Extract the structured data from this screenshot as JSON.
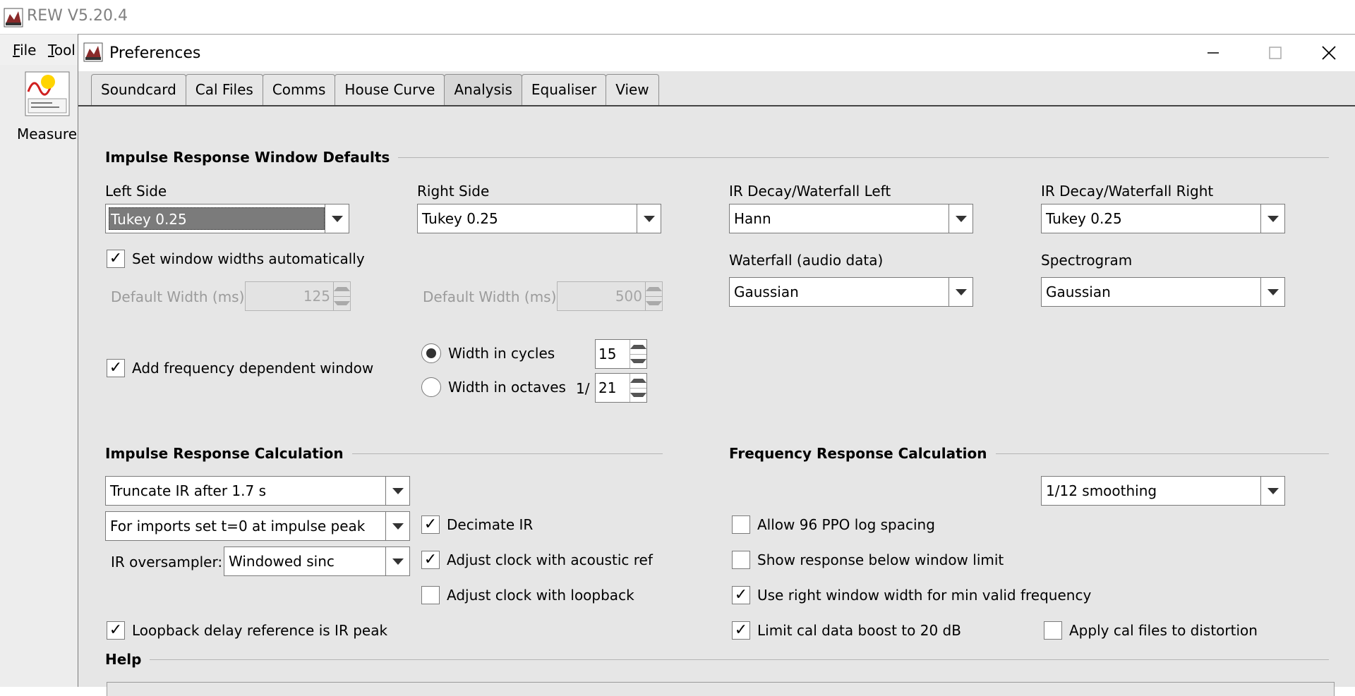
{
  "app": {
    "title": "REW V5.20.4",
    "menu": {
      "file": "File",
      "tools": "Tool"
    },
    "measure_label": "Measure"
  },
  "dialog": {
    "title": "Preferences",
    "tabs": [
      "Soundcard",
      "Cal Files",
      "Comms",
      "House Curve",
      "Analysis",
      "Equaliser",
      "View"
    ],
    "active_tab": "Analysis"
  },
  "ir_window": {
    "section_title": "Impulse Response Window Defaults",
    "left_side": {
      "label": "Left Side",
      "value": "Tukey 0.25"
    },
    "right_side": {
      "label": "Right Side",
      "value": "Tukey 0.25"
    },
    "ir_decay_left": {
      "label": "IR Decay/Waterfall Left",
      "value": "Hann"
    },
    "ir_decay_right": {
      "label": "IR Decay/Waterfall Right",
      "value": "Tukey 0.25"
    },
    "waterfall_audio": {
      "label": "Waterfall (audio data)",
      "value": "Gaussian"
    },
    "spectrogram": {
      "label": "Spectrogram",
      "value": "Gaussian"
    },
    "set_widths_auto": {
      "label": "Set window widths automatically",
      "checked": true
    },
    "left_default_width": {
      "label": "Default Width (ms)",
      "value": "125"
    },
    "right_default_width": {
      "label": "Default Width (ms)",
      "value": "500"
    },
    "freq_dependent": {
      "label": "Add frequency dependent window",
      "checked": true
    },
    "width_cycles": {
      "label": "Width in cycles",
      "value": "15",
      "selected": true
    },
    "width_octaves": {
      "label": "Width in octaves",
      "prefix": "1/",
      "value": "21",
      "selected": false
    }
  },
  "ir_calc": {
    "section_title": "Impulse Response Calculation",
    "truncate": "Truncate IR after 1.7 s",
    "imports": "For imports set t=0 at impulse peak",
    "oversampler_label": "IR oversampler:",
    "oversampler": "Windowed sinc",
    "decimate": {
      "label": "Decimate IR",
      "checked": true
    },
    "adjust_acoustic": {
      "label": "Adjust clock with acoustic ref",
      "checked": true
    },
    "adjust_loopback": {
      "label": "Adjust clock with loopback",
      "checked": false
    },
    "loopback_delay": {
      "label": "Loopback delay reference is IR peak",
      "checked": true
    }
  },
  "fr_calc": {
    "section_title": "Frequency Response Calculation",
    "allow_96": {
      "label": "Allow 96 PPO log spacing",
      "checked": false
    },
    "smoothing": "1/12 smoothing",
    "show_below": {
      "label": "Show response below window limit",
      "checked": false
    },
    "use_right_width": {
      "label": "Use right window width for min valid frequency",
      "checked": true
    },
    "limit_cal": {
      "label": "Limit cal data boost to 20 dB",
      "checked": true
    },
    "apply_cal": {
      "label": "Apply cal files to distortion",
      "checked": false
    }
  },
  "help": {
    "section_title": "Help"
  },
  "icons": {
    "check_mark": "✓",
    "close": "✕"
  }
}
